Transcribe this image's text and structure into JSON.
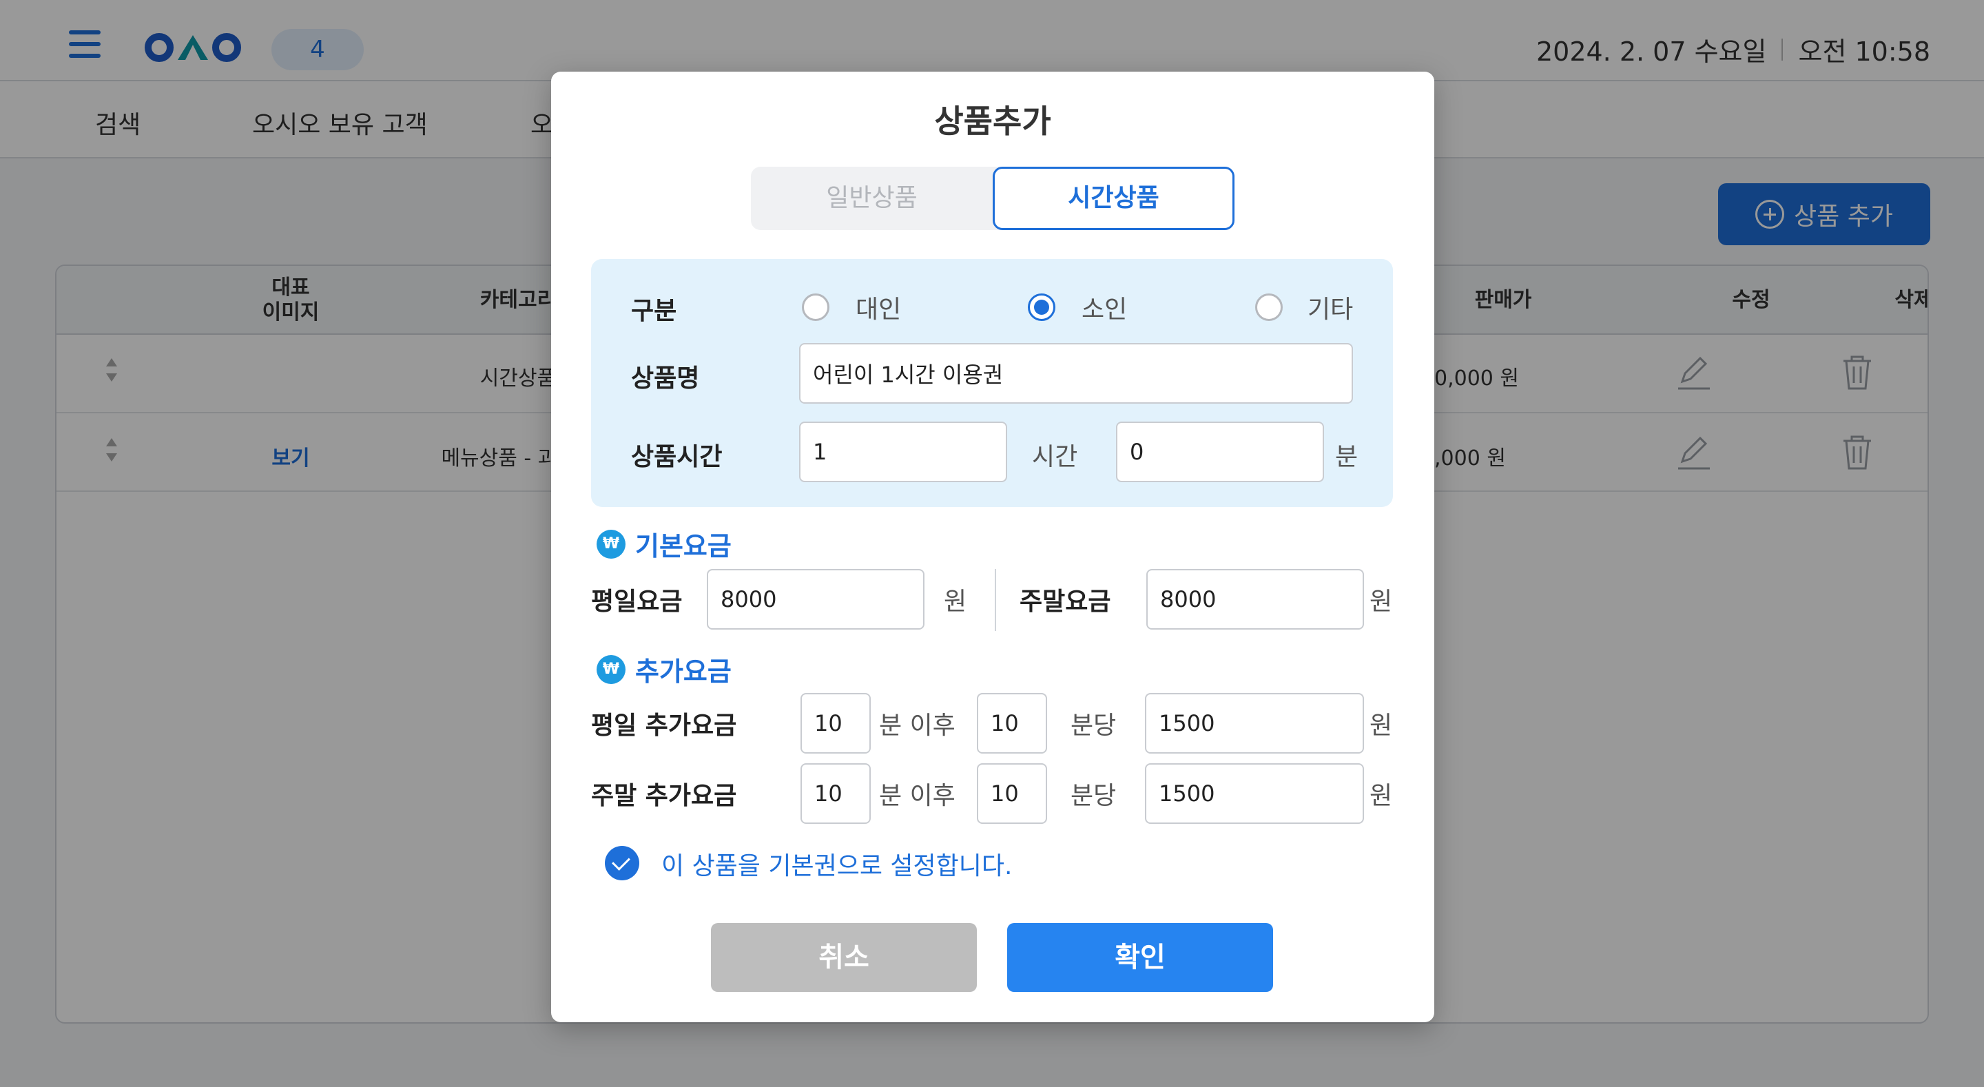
{
  "app": {
    "badge_count": "4",
    "date": "2024. 2. 07 수요일",
    "time": "오전 10:58"
  },
  "nav": {
    "items": [
      "검색",
      "오시오 보유 고객",
      "오"
    ]
  },
  "toolbar": {
    "add_product_label": "상품 추가"
  },
  "table": {
    "headers": {
      "image": "대표\n이미지",
      "category": "카테고리",
      "price": "판매가",
      "edit": "수정",
      "delete": "삭제"
    },
    "rows": [
      {
        "image": "",
        "category": "시간상품",
        "price": "0,000 원"
      },
      {
        "image": "보기",
        "category": "메뉴상품 - 과자류",
        "price": ",000 원"
      }
    ]
  },
  "modal": {
    "title": "상품추가",
    "tabs": [
      {
        "label": "일반상품",
        "active": false
      },
      {
        "label": "시간상품",
        "active": true
      }
    ],
    "type": {
      "label": "구분",
      "options": [
        {
          "label": "대인",
          "checked": false
        },
        {
          "label": "소인",
          "checked": true
        },
        {
          "label": "기타",
          "checked": false
        }
      ]
    },
    "product_name": {
      "label": "상품명",
      "value": "어린이 1시간 이용권"
    },
    "product_time": {
      "label": "상품시간",
      "hours": "1",
      "hours_unit": "시간",
      "minutes": "0",
      "minutes_unit": "분"
    },
    "base_fee": {
      "title": "기본요금",
      "won_symbol": "₩",
      "weekday_label": "평일요금",
      "weekday_value": "8000",
      "weekend_label": "주말요금",
      "weekend_value": "8000",
      "unit": "원"
    },
    "extra_fee": {
      "title": "추가요금",
      "won_symbol": "₩",
      "after_unit": "분 이후",
      "per_unit": "분당",
      "currency_unit": "원",
      "weekday": {
        "label": "평일 추가요금",
        "after_minutes": "10",
        "per_minutes": "10",
        "amount": "1500"
      },
      "weekend": {
        "label": "주말 추가요금",
        "after_minutes": "10",
        "per_minutes": "10",
        "amount": "1500"
      }
    },
    "default_ticket": {
      "checked": true,
      "label": "이 상품을 기본권으로 설정합니다."
    },
    "cancel_label": "취소",
    "confirm_label": "확인"
  },
  "colors": {
    "accent": "#1e6fd9",
    "confirm": "#2684f0",
    "cancel": "#bdbdbd",
    "info_bg": "#e2f2fc"
  }
}
